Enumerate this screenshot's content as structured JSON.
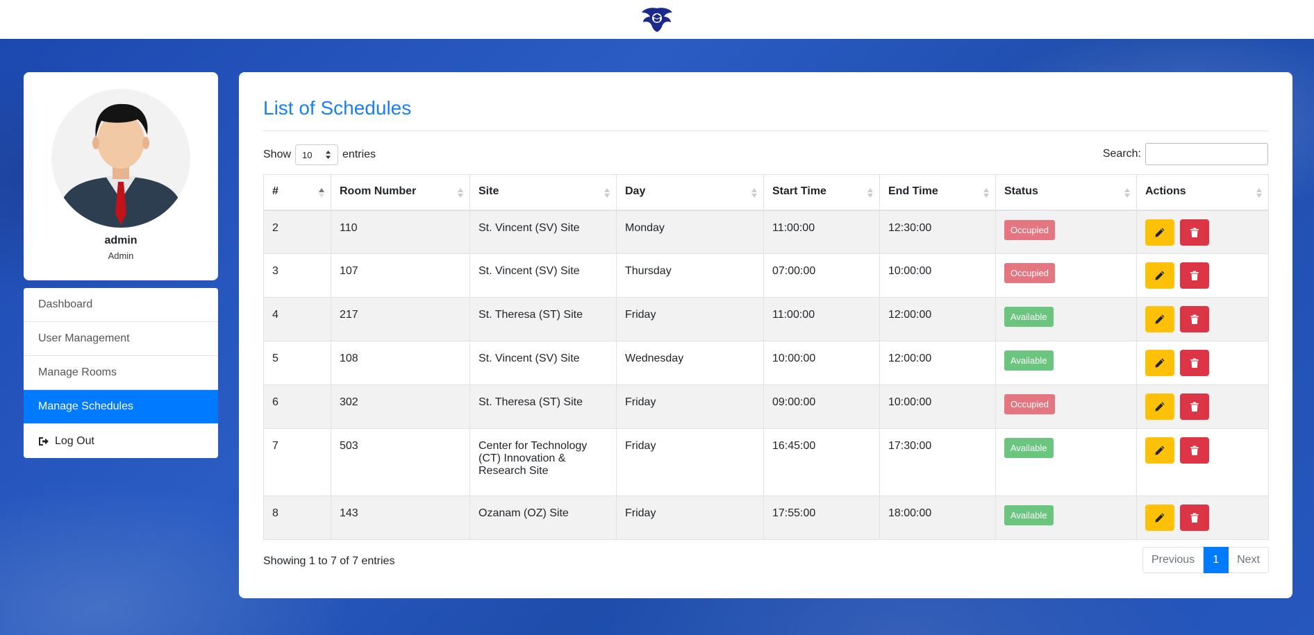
{
  "profile": {
    "name": "admin",
    "role": "Admin"
  },
  "nav": {
    "items": [
      {
        "label": "Dashboard"
      },
      {
        "label": "User Management"
      },
      {
        "label": "Manage Rooms"
      },
      {
        "label": "Manage Schedules"
      }
    ],
    "logout": "Log Out"
  },
  "page": {
    "title": "List of Schedules"
  },
  "controls": {
    "show_label": "Show",
    "entries_label": "entries",
    "length_value": "10",
    "search_label": "Search:",
    "search_value": ""
  },
  "table": {
    "headers": [
      "#",
      "Room Number",
      "Site",
      "Day",
      "Start Time",
      "End Time",
      "Status",
      "Actions"
    ],
    "rows": [
      {
        "id": "2",
        "room": "110",
        "site": "St. Vincent (SV) Site",
        "day": "Monday",
        "start": "11:00:00",
        "end": "12:30:00",
        "status": "Occupied"
      },
      {
        "id": "3",
        "room": "107",
        "site": "St. Vincent (SV) Site",
        "day": "Thursday",
        "start": "07:00:00",
        "end": "10:00:00",
        "status": "Occupied"
      },
      {
        "id": "4",
        "room": "217",
        "site": "St. Theresa (ST) Site",
        "day": "Friday",
        "start": "11:00:00",
        "end": "12:00:00",
        "status": "Available"
      },
      {
        "id": "5",
        "room": "108",
        "site": "St. Vincent (SV) Site",
        "day": "Wednesday",
        "start": "10:00:00",
        "end": "12:00:00",
        "status": "Available"
      },
      {
        "id": "6",
        "room": "302",
        "site": "St. Theresa (ST) Site",
        "day": "Friday",
        "start": "09:00:00",
        "end": "10:00:00",
        "status": "Occupied"
      },
      {
        "id": "7",
        "room": "503",
        "site": "Center for Technology (CT) Innovation & Research Site",
        "day": "Friday",
        "start": "16:45:00",
        "end": "17:30:00",
        "status": "Available"
      },
      {
        "id": "8",
        "room": "143",
        "site": "Ozanam (OZ) Site",
        "day": "Friday",
        "start": "17:55:00",
        "end": "18:00:00",
        "status": "Available"
      }
    ]
  },
  "footer": {
    "info": "Showing 1 to 7 of 7 entries",
    "previous": "Previous",
    "current_page": "1",
    "next": "Next"
  },
  "icons": {
    "logo": "eagle-logo-icon",
    "edit": "pencil-icon",
    "delete": "trash-icon",
    "logout": "sign-out-icon",
    "sort": "sort-arrows-icon"
  },
  "colors": {
    "accent": "#007bff",
    "title": "#1a7ff5",
    "occupied": "#e37680",
    "available": "#6cc57f",
    "edit_button": "#ffc107",
    "delete_button": "#dc3545"
  }
}
